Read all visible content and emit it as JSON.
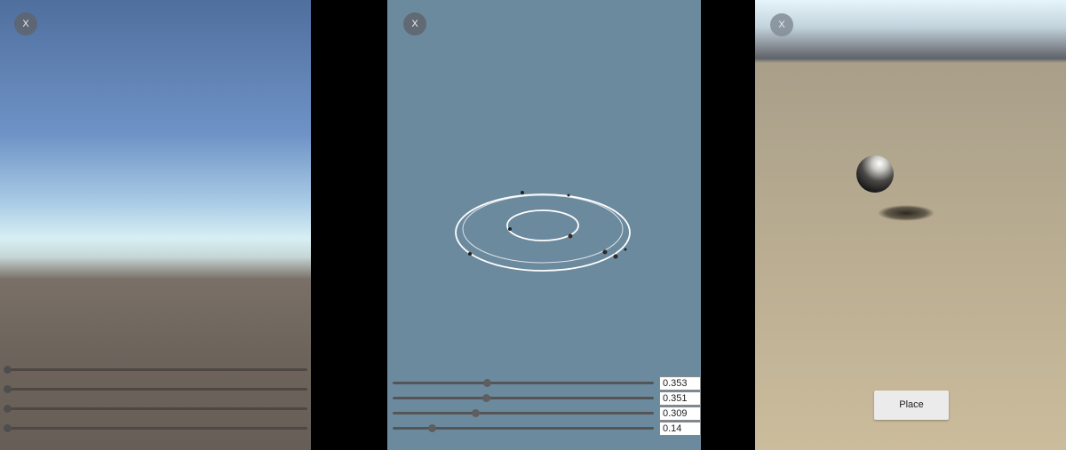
{
  "close_label": "X",
  "panel1": {
    "sliders": [
      {
        "value": 0.0
      },
      {
        "value": 0.0
      },
      {
        "value": 0.0
      },
      {
        "value": 0.0
      }
    ]
  },
  "panel2": {
    "sliders": [
      {
        "value": 0.353,
        "label": "0.353"
      },
      {
        "value": 0.351,
        "label": "0.351"
      },
      {
        "value": 0.309,
        "label": "0.309"
      },
      {
        "value": 0.14,
        "label": "0.14"
      }
    ]
  },
  "panel3": {
    "place_label": "Place"
  }
}
